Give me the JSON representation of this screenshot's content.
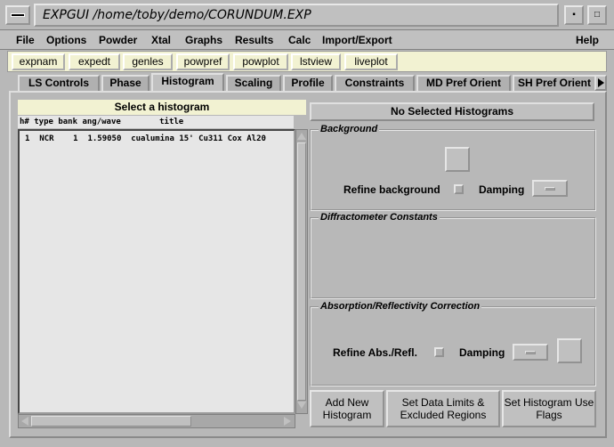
{
  "window": {
    "title": "EXPGUI /home/toby/demo/CORUNDUM.EXP"
  },
  "menubar": {
    "items": [
      "File",
      "Options",
      "Powder",
      "Xtal",
      "Graphs",
      "Results",
      "Calc",
      "Import/Export"
    ],
    "help": "Help"
  },
  "toolbar": {
    "buttons": [
      "expnam",
      "expedt",
      "genles",
      "powpref",
      "powplot",
      "lstview",
      "liveplot"
    ]
  },
  "tabs": [
    "LS Controls",
    "Phase",
    "Histogram",
    "Scaling",
    "Profile",
    "Constraints",
    "MD Pref Orient",
    "SH Pref Orient"
  ],
  "active_tab": "Histogram",
  "histogram_list": {
    "header": "Select a histogram",
    "columns": "h# type bank ang/wave        title",
    "rows": [
      "1  NCR    1  1.59050  cualumina 15' Cu311 Cox Al20"
    ]
  },
  "right_panel": {
    "selection_status": "No Selected Histograms",
    "background": {
      "label": "Background",
      "refine_label": "Refine background",
      "damping_label": "Damping"
    },
    "diffractometer": {
      "label": "Diffractometer Constants"
    },
    "absorption": {
      "label": "Absorption/Reflectivity Correction",
      "refine_label": "Refine Abs./Refl.",
      "damping_label": "Damping"
    },
    "buttons": {
      "add_new": "Add New Histogram",
      "set_limits": "Set Data Limits & Excluded Regions",
      "set_flags": "Set Histogram Use Flags"
    }
  }
}
